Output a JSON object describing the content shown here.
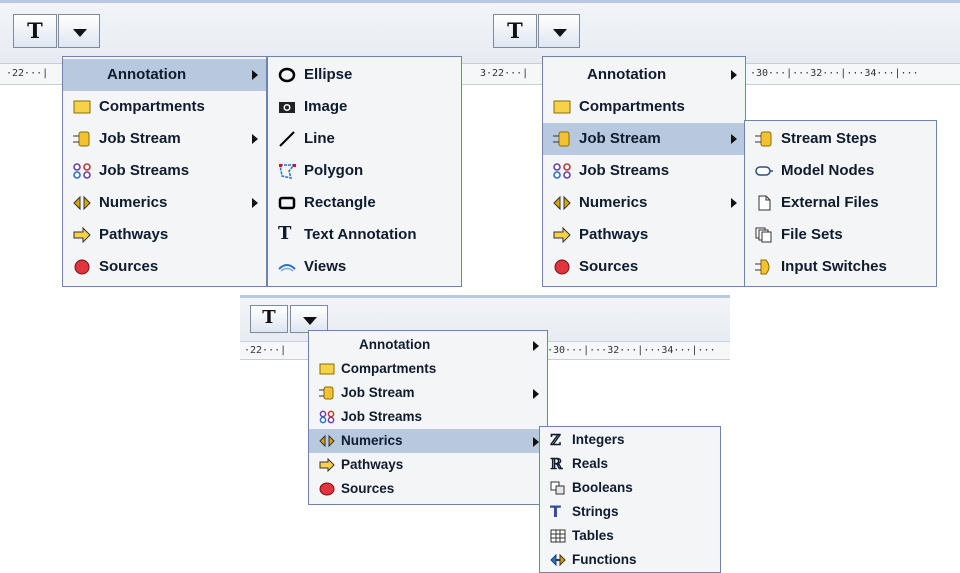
{
  "toolbar": {
    "text_button_glyph": "T",
    "ruler_left": "·22···|",
    "ruler_mid": "3·22···|",
    "ruler_right": "·30···|···32···|···34···|···"
  },
  "main_menu": {
    "items": [
      {
        "label": "Annotation",
        "icon": "none",
        "submenu": true
      },
      {
        "label": "Compartments",
        "icon": "compartment-icon",
        "submenu": false
      },
      {
        "label": "Job Stream",
        "icon": "job-stream-icon",
        "submenu": true
      },
      {
        "label": "Job Streams",
        "icon": "job-streams-icon",
        "submenu": false
      },
      {
        "label": "Numerics",
        "icon": "numerics-icon",
        "submenu": true
      },
      {
        "label": "Pathways",
        "icon": "pathways-icon",
        "submenu": false
      },
      {
        "label": "Sources",
        "icon": "sources-icon",
        "submenu": false
      }
    ]
  },
  "annotation_submenu": {
    "items": [
      {
        "label": "Ellipse",
        "icon": "ellipse-icon"
      },
      {
        "label": "Image",
        "icon": "image-icon"
      },
      {
        "label": "Line",
        "icon": "line-icon"
      },
      {
        "label": "Polygon",
        "icon": "polygon-icon"
      },
      {
        "label": "Rectangle",
        "icon": "rectangle-icon"
      },
      {
        "label": "Text Annotation",
        "icon": "text-icon",
        "glyph": "T"
      },
      {
        "label": "Views",
        "icon": "views-icon"
      }
    ]
  },
  "job_stream_submenu": {
    "items": [
      {
        "label": "Stream Steps",
        "icon": "stream-steps-icon"
      },
      {
        "label": "Model Nodes",
        "icon": "model-nodes-icon"
      },
      {
        "label": "External Files",
        "icon": "external-files-icon"
      },
      {
        "label": "File Sets",
        "icon": "file-sets-icon"
      },
      {
        "label": "Input Switches",
        "icon": "input-switches-icon"
      }
    ]
  },
  "numerics_submenu": {
    "items": [
      {
        "label": "Integers",
        "icon": "integers-icon",
        "glyph": "ℤ"
      },
      {
        "label": "Reals",
        "icon": "reals-icon",
        "glyph": "ℝ"
      },
      {
        "label": "Booleans",
        "icon": "booleans-icon"
      },
      {
        "label": "Strings",
        "icon": "strings-icon",
        "glyph": "T"
      },
      {
        "label": "Tables",
        "icon": "tables-icon"
      },
      {
        "label": "Functions",
        "icon": "functions-icon"
      }
    ]
  },
  "colors": {
    "highlight": "#b8c8df",
    "menu_bg": "#f4f5f7",
    "menu_border": "#6e84ad",
    "compartment_fill": "#f6d24a",
    "source_fill": "#e2343e",
    "stream_fill": "#f3c231"
  }
}
